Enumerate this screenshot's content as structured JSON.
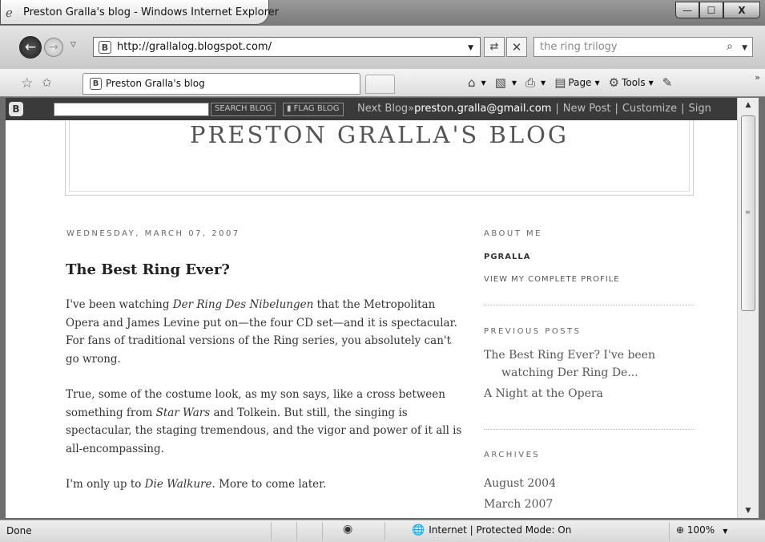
{
  "window": {
    "title": "Preston Gralla's blog - Windows Internet Explorer",
    "controls": {
      "minimize": "—",
      "maximize": "☐",
      "close": "X"
    }
  },
  "nav": {
    "address": "http://grallalog.blogspot.com/",
    "search_value": "the ring trilogy"
  },
  "tabs": {
    "active_label": "Preston Gralla's blog"
  },
  "commands": {
    "page_label": "Page",
    "tools_label": "Tools"
  },
  "blogger_bar": {
    "search_blog_label": "SEARCH BLOG",
    "flag_blog_label": "▮ FLAG BLOG",
    "next_blog": "Next Blog»",
    "email": "preston.gralla@gmail.com",
    "new_post": "New Post",
    "customize": "Customize",
    "sign": "Sign"
  },
  "blog": {
    "title": "PRESTON GRALLA'S BLOG",
    "date_header": "WEDNESDAY, MARCH 07, 2007",
    "post_title": "The Best Ring Ever?",
    "paragraphs": [
      {
        "before": "I've been watching ",
        "italic": "Der Ring Des Nibelungen",
        "after": " that the Metropolitan Opera and James Levine put on—the four CD set—and it is spectacular. For fans of traditional versions of the Ring series, you absolutely can't go wrong."
      },
      {
        "before": "True, some of the costume look, as my son says, like a cross between something from ",
        "italic": "Star Wars",
        "after": " and Tolkein. But still, the singing is spectacular, the staging tremendous, and the vigor and power of it all is all-encompassing."
      },
      {
        "before": "I'm only up to ",
        "italic": "Die Walkure",
        "after": ". More to come later."
      }
    ]
  },
  "sidebar": {
    "about_me_heading": "ABOUT ME",
    "author": "PGRALLA",
    "profile_link": "VIEW MY COMPLETE PROFILE",
    "previous_posts_heading": "PREVIOUS POSTS",
    "previous_posts": [
      "The Best Ring Ever? I've been watching Der Ring De...",
      "A Night at the Opera"
    ],
    "archives_heading": "ARCHIVES",
    "archives": [
      "August 2004",
      "March 2007"
    ]
  },
  "status": {
    "text": "Done",
    "zone": "Internet | Protected Mode: On",
    "zoom": "100%"
  }
}
